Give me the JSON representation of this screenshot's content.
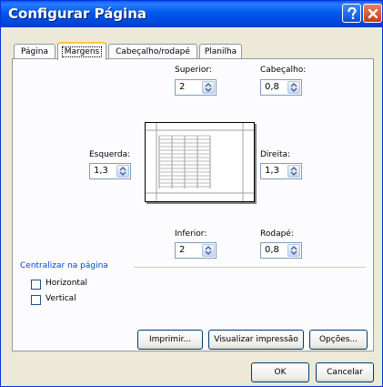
{
  "window": {
    "title": "Configurar Página",
    "help_icon": "question-mark",
    "close_icon": "x-close"
  },
  "tabs": [
    {
      "label": "Página",
      "active": false
    },
    {
      "label": "Margens",
      "active": true
    },
    {
      "label": "Cabeçalho/rodapé",
      "active": false
    },
    {
      "label": "Planilha",
      "active": false
    }
  ],
  "margins": {
    "top": {
      "label": "Superior:",
      "value": "2"
    },
    "header": {
      "label": "Cabeçalho:",
      "value": "0,8"
    },
    "left": {
      "label": "Esquerda:",
      "value": "1,3"
    },
    "right": {
      "label": "Direita:",
      "value": "1,3"
    },
    "bottom": {
      "label": "Inferior:",
      "value": "2"
    },
    "footer": {
      "label": "Rodapé:",
      "value": "0,8"
    }
  },
  "center": {
    "section_label": "Centralizar na página",
    "horizontal": {
      "label": "Horizontal",
      "checked": false
    },
    "vertical": {
      "label": "Vertical",
      "checked": false
    }
  },
  "panel_buttons": {
    "print": "Imprimir...",
    "preview": "Visualizar impressão",
    "options": "Opções..."
  },
  "dialog_buttons": {
    "ok": "OK",
    "cancel": "Cancelar"
  },
  "colors": {
    "titlebar": "#0058ee",
    "section_label": "#0046d5",
    "active_tab_highlight": "#ffc83c",
    "dialog_face": "#ece9d8"
  }
}
